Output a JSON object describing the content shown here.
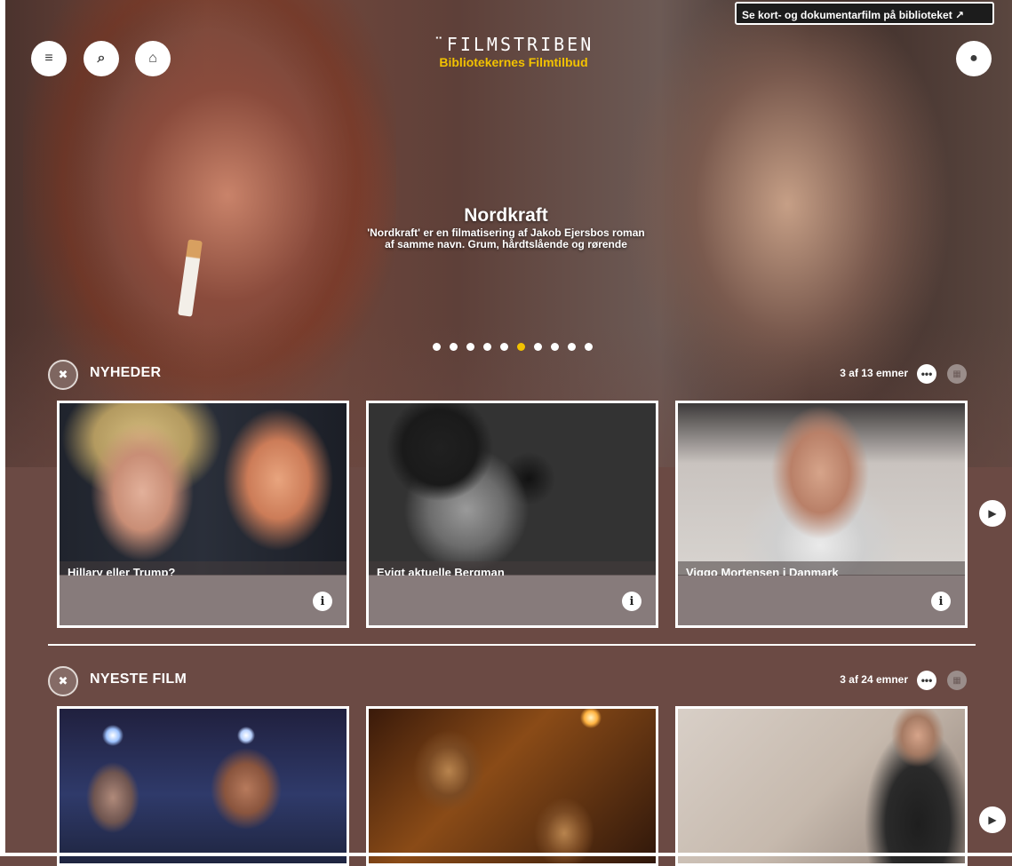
{
  "header": {
    "logo_text": "¨FILMSTRIBEN",
    "tagline": "Bibliotekernes Filmtilbud",
    "external_link": "Se kort- og dokumentarfilm på biblioteket ↗"
  },
  "hero": {
    "title": "Nordkraft",
    "description": "'Nordkraft' er en filmatisering af Jakob Ejersbos roman af samme navn. Grum, hårdtslående og rørende",
    "slide_count": 10,
    "active_slide": 6
  },
  "sections": [
    {
      "title": "NYHEDER",
      "count_text": "3 af 13 emner",
      "cards": [
        {
          "caption": "Hillary eller Trump?"
        },
        {
          "caption": "Evigt aktuelle Bergman"
        },
        {
          "caption": "Viggo Mortensen i Danmark"
        }
      ]
    },
    {
      "title": "NYESTE FILM",
      "count_text": "3 af 24 emner",
      "cards": [
        {
          "caption": ""
        },
        {
          "caption": ""
        },
        {
          "caption": ""
        }
      ]
    }
  ],
  "icons": {
    "menu": "≡",
    "search": "⌕",
    "home": "⌂",
    "user": "●",
    "close": "✖",
    "more": "•••",
    "grid": "▦",
    "info": "i",
    "next": "▶"
  },
  "colors": {
    "accent": "#f2c200",
    "background": "#6b4a44"
  }
}
